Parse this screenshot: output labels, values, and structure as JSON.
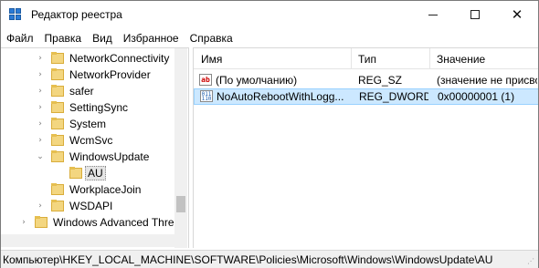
{
  "window": {
    "title": "Редактор реестра",
    "accent_color": "#cce8ff"
  },
  "menu": [
    {
      "label": "Файл"
    },
    {
      "label": "Правка"
    },
    {
      "label": "Вид"
    },
    {
      "label": "Избранное"
    },
    {
      "label": "Справка"
    }
  ],
  "tree": {
    "items": [
      {
        "label": "NetworkConnectivity",
        "expander": "›",
        "icon": "folder-icon"
      },
      {
        "label": "NetworkProvider",
        "expander": "›",
        "icon": "folder-icon"
      },
      {
        "label": "safer",
        "expander": "›",
        "icon": "folder-icon"
      },
      {
        "label": "SettingSync",
        "expander": "›",
        "icon": "folder-icon"
      },
      {
        "label": "System",
        "expander": "›",
        "icon": "folder-icon"
      },
      {
        "label": "WcmSvc",
        "expander": "›",
        "icon": "folder-icon"
      },
      {
        "label": "WindowsUpdate",
        "expander": "⌄",
        "icon": "folder-icon"
      },
      {
        "label": "AU",
        "expander": "",
        "icon": "folder-icon",
        "selected": true
      },
      {
        "label": "WorkplaceJoin",
        "expander": "",
        "icon": "folder-icon"
      },
      {
        "label": "WSDAPI",
        "expander": "›",
        "icon": "folder-icon"
      },
      {
        "label": "Windows Advanced Thre",
        "expander": "›",
        "icon": "folder-icon"
      }
    ]
  },
  "list": {
    "columns": [
      "Имя",
      "Тип",
      "Значение"
    ],
    "rows": [
      {
        "name": "(По умолчанию)",
        "type": "REG_SZ",
        "value": "(значение не присво",
        "icon": "string-value-icon"
      },
      {
        "name": "NoAutoRebootWithLogg...",
        "type": "REG_DWORD",
        "value": "0x00000001 (1)",
        "icon": "dword-value-icon",
        "selected": true
      }
    ]
  },
  "status": {
    "path": "Компьютер\\HKEY_LOCAL_MACHINE\\SOFTWARE\\Policies\\Microsoft\\Windows\\WindowsUpdate\\AU"
  }
}
